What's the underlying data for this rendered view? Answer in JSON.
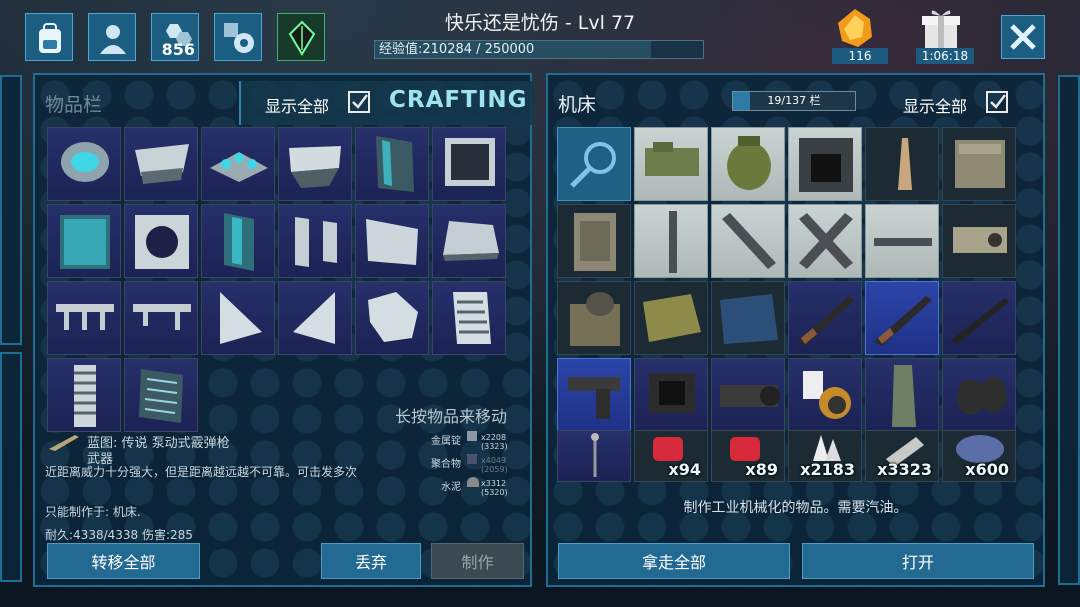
{
  "header": {
    "title": "快乐还是忧伤 - Lvl 77",
    "xp_label": "经验值:210284 / 250000",
    "xp_fraction": 0.841,
    "points_count": "856",
    "amber_count": "116",
    "gift_timer": "1:06:18"
  },
  "inventory": {
    "title": "物品栏",
    "show_all_label": "显示全部",
    "crafting_label": "CRAFTING",
    "hint": "长按物品来移动",
    "transfer_all": "转移全部",
    "drop": "丢弃",
    "craft": "制作"
  },
  "detail": {
    "title": "蓝图: 传说 泵动式霰弹枪",
    "category": "武器",
    "description": "近距离威力十分强大，但是距离越远越不可靠。可击发多次",
    "craftable_in": "只能制作于: 机床.",
    "stats": "耐久:4338/4338 伤害:285",
    "requirements": [
      {
        "name": "金属锭",
        "amount": "x2208 (3323)"
      },
      {
        "name": "聚合物",
        "amount": "x4049 (2059)"
      },
      {
        "name": "水泥",
        "amount": "x3312 (5320)"
      }
    ]
  },
  "machine": {
    "title": "机床",
    "slots_label": "19/137 栏",
    "slots_fraction": 0.139,
    "show_all_label": "显示全部",
    "description": "制作工业机械化的物品。需要汽油。",
    "take_all": "拿走全部",
    "open": "打开",
    "counts": [
      "x94",
      "x89",
      "x2183",
      "x3323",
      "x600"
    ]
  },
  "colors": {
    "panel_border": "#1f6d93",
    "button": "#236a92",
    "crafting_accent": "#9ee3ef"
  }
}
